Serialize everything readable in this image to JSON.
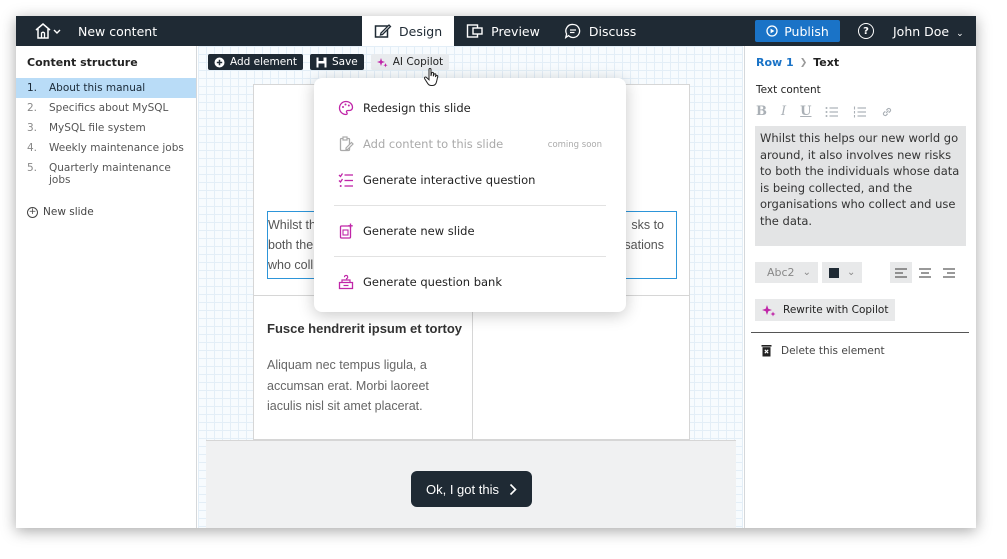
{
  "header": {
    "title": "New content",
    "tabs": [
      {
        "label": "Design",
        "icon": "design-icon",
        "active": true
      },
      {
        "label": "Preview",
        "icon": "preview-icon",
        "active": false
      },
      {
        "label": "Discuss",
        "icon": "discuss-icon",
        "active": false
      }
    ],
    "publish_label": "Publish",
    "help_label": "?",
    "user_name": "John Doe"
  },
  "sidebar": {
    "title": "Content structure",
    "items": [
      {
        "num": "1.",
        "label": "About this manual",
        "active": true
      },
      {
        "num": "2.",
        "label": "Specifics about MySQL",
        "active": false
      },
      {
        "num": "3.",
        "label": "MySQL file system",
        "active": false
      },
      {
        "num": "4.",
        "label": "Weekly maintenance jobs",
        "active": false
      },
      {
        "num": "5.",
        "label": "Quarterly maintenance jobs",
        "active": false
      }
    ],
    "new_slide_label": "New slide"
  },
  "toolbar": {
    "add_element_label": "Add element",
    "save_label": "Save",
    "ai_copilot_label": "AI Copilot"
  },
  "slide": {
    "textbox_left_lines": [
      "Whilst th",
      "both the",
      "who coll"
    ],
    "textbox_right_lines": [
      "sks to",
      "sations"
    ],
    "card_title": "Fusce hendrerit ipsum et tortoy",
    "card_body": "Aliquam nec tempus ligula, a accumsan erat. Morbi laoreet iaculis nisl sit amet placerat.",
    "ok_label": "Ok, I got this"
  },
  "copilot_menu": {
    "redesign_label": "Redesign this slide",
    "add_content_label": "Add content to this slide",
    "coming_soon_label": "coming soon",
    "interactive_question_label": "Generate interactive question",
    "new_slide_label": "Generate new slide",
    "question_bank_label": "Generate question bank"
  },
  "properties": {
    "breadcrumb_row": "Row 1",
    "breadcrumb_item": "Text",
    "text_content_label": "Text content",
    "text_content": "Whilst this helps our new world go around, it also involves new risks to both the individuals whose data is being collected, and the organisations who collect and use the data.",
    "text_style": "Abc2",
    "text_color": "#1f2a34",
    "rewrite_label": "Rewrite with Copilot",
    "delete_label": "Delete this element"
  },
  "colors": {
    "topbar": "#1f2a34",
    "accent": "#1a73c7",
    "selection": "#2d95d9",
    "copilot": "#c026a8"
  }
}
